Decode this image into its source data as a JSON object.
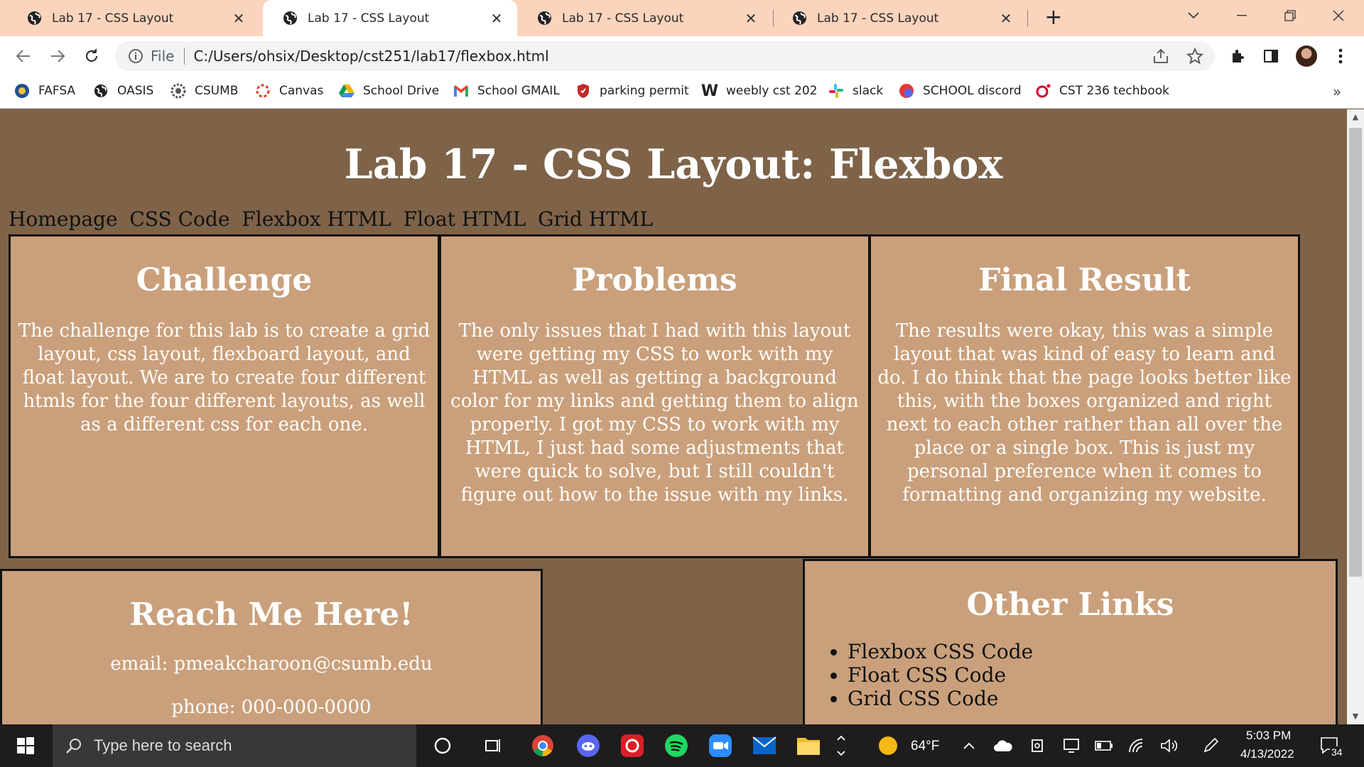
{
  "browser": {
    "tabs": [
      {
        "title": "Lab 17 - CSS Layout",
        "active": false
      },
      {
        "title": "Lab 17 - CSS Layout",
        "active": true
      },
      {
        "title": "Lab 17 - CSS Layout",
        "active": false
      },
      {
        "title": "Lab 17 - CSS Layout",
        "active": false
      }
    ],
    "new_tab_label": "+",
    "address": {
      "scheme_label": "File",
      "url": "C:/Users/ohsix/Desktop/cst251/lab17/flexbox.html"
    },
    "bookmarks": [
      {
        "label": "FAFSA",
        "icon": "fafsa-icon"
      },
      {
        "label": "OASIS",
        "icon": "globe-icon"
      },
      {
        "label": "CSUMB",
        "icon": "csumb-icon"
      },
      {
        "label": "Canvas",
        "icon": "canvas-icon"
      },
      {
        "label": "School Drive",
        "icon": "drive-icon"
      },
      {
        "label": "School GMAIL",
        "icon": "gmail-icon"
      },
      {
        "label": "parking permit",
        "icon": "shield-icon"
      },
      {
        "label": "weebly cst 202",
        "icon": "weebly-icon"
      },
      {
        "label": "slack",
        "icon": "slack-icon"
      },
      {
        "label": "SCHOOL discord",
        "icon": "discord-icon"
      },
      {
        "label": "CST 236 techbook",
        "icon": "oreilly-icon"
      }
    ],
    "bookmarks_overflow": "»"
  },
  "page": {
    "title": "Lab 17 - CSS Layout: Flexbox",
    "nav_links": [
      "Homepage",
      "CSS Code",
      "Flexbox HTML",
      "Float HTML",
      "Grid HTML"
    ],
    "boxes": [
      {
        "heading": "Challenge",
        "text": "The challenge for this lab is to create a grid layout, css layout, flexboard layout, and float layout. We are to create four different htmls for the four different layouts, as well as a different css for each one."
      },
      {
        "heading": "Problems",
        "text": "The only issues that I had with this layout were getting my CSS to work with my HTML as well as getting a background color for my links and getting them to align properly. I got my CSS to work with my HTML, I just had some adjustments that were quick to solve, but I still couldn't figure out how to the issue with my links."
      },
      {
        "heading": "Final Result",
        "text": "The results were okay, this was a simple layout that was kind of easy to learn and do. I do think that the page looks better like this, with the boxes organized and right next to each other rather than all over the place or a single box. This is just my personal preference when it comes to formatting and organizing my website."
      }
    ],
    "contact": {
      "heading": "Reach Me Here!",
      "email": "email: pmeakcharoon@csumb.edu",
      "phone": "phone: 000-000-0000"
    },
    "other_links": {
      "heading": "Other Links",
      "items": [
        "Flexbox CSS Code",
        "Float CSS Code",
        "Grid CSS Code"
      ]
    }
  },
  "taskbar": {
    "search_placeholder": "Type here to search",
    "weather": "64°F",
    "time": "5:03 PM",
    "date": "4/13/2022",
    "notification_count": "34"
  },
  "colors": {
    "page_bg": "#7e6349",
    "box_bg": "#c9a07b",
    "tabstrip_bg": "#fbd4bd"
  }
}
